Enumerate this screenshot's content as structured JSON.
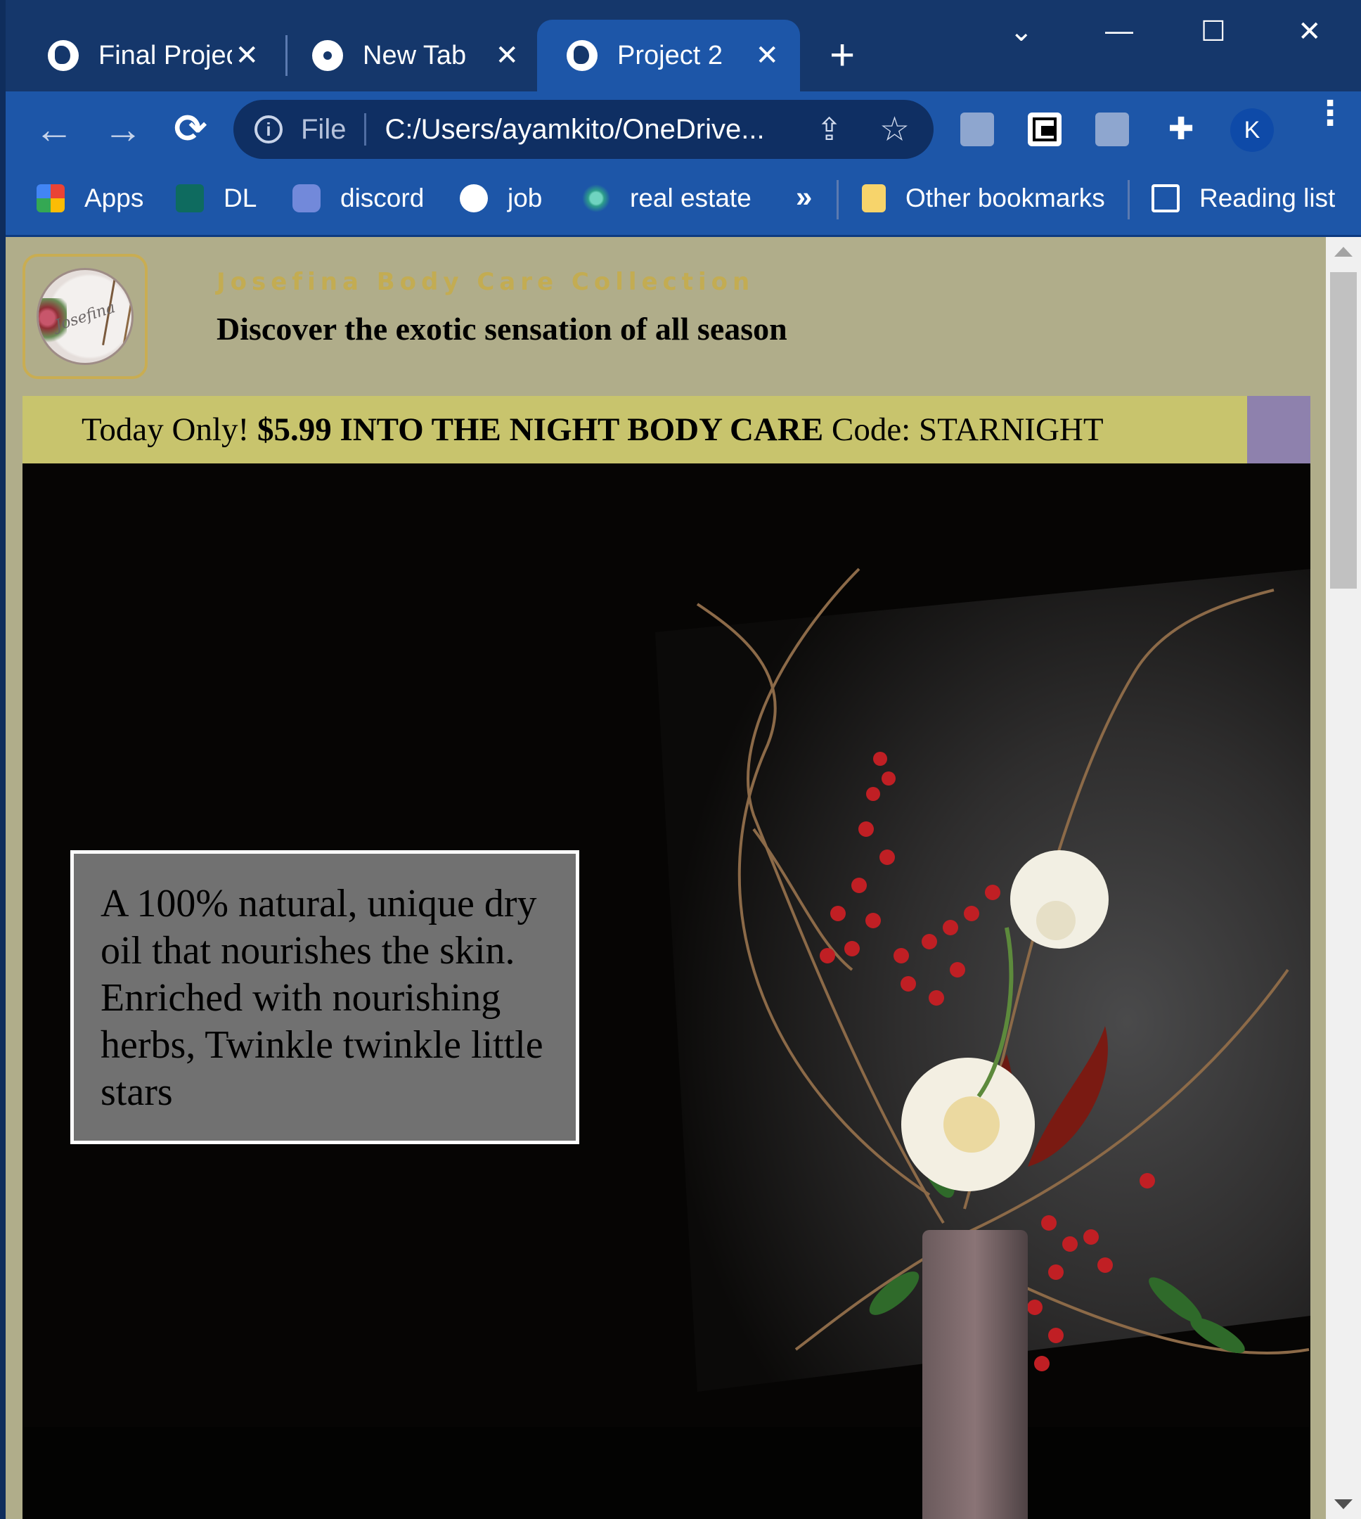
{
  "browser": {
    "tabs": [
      {
        "title": "Final Projec",
        "close": "✕",
        "icon": "globe-icon"
      },
      {
        "title": "New Tab",
        "close": "✕",
        "icon": "chrome-icon"
      },
      {
        "title": "Project 2",
        "close": "✕",
        "icon": "globe-icon",
        "active": true
      }
    ],
    "new_tab": "+",
    "window_controls": {
      "dropdown": "⌄",
      "minimize": "—",
      "maximize": "☐",
      "close": "✕"
    },
    "toolbar": {
      "back": "←",
      "forward": "→",
      "reload": "⟳",
      "omnibox": {
        "info": "i",
        "scheme": "File",
        "url": "C:/Users/ayamkito/OneDrive..."
      },
      "profile_initial": "K",
      "menu": "⋮"
    },
    "bookmarks": [
      {
        "label": "Apps",
        "icon": "apps-grid-icon"
      },
      {
        "label": "DL",
        "icon": "ny-state-icon"
      },
      {
        "label": "discord",
        "icon": "discord-icon"
      },
      {
        "label": "job",
        "icon": "globe-icon"
      },
      {
        "label": "real estate",
        "icon": "sparkle-icon"
      }
    ],
    "bookmarks_more": "»",
    "other_bookmarks": "Other bookmarks",
    "reading_list": "Reading list"
  },
  "page": {
    "brand": "Josefina Body Care Collection",
    "logo_script": "Josefina",
    "tagline": "Discover the exotic sensation of all season",
    "promo": {
      "prefix": "Today Only!",
      "highlight": "$5.99 INTO THE NIGHT BODY CARE",
      "code": "Code: STARNIGHT"
    },
    "caption": "A 100% natural, unique dry oil that nourishes the skin. Enriched with nourishing herbs, Twinkle twinkle little stars"
  },
  "colors": {
    "tab_strip": "#15376b",
    "toolbar": "#1d56a8",
    "page_bg": "#b0ad8a",
    "brand_gold": "#c3ac52",
    "promo_bar": "#c8c46d",
    "promo_side": "#8e81ad",
    "caption_bg": "#717171"
  }
}
